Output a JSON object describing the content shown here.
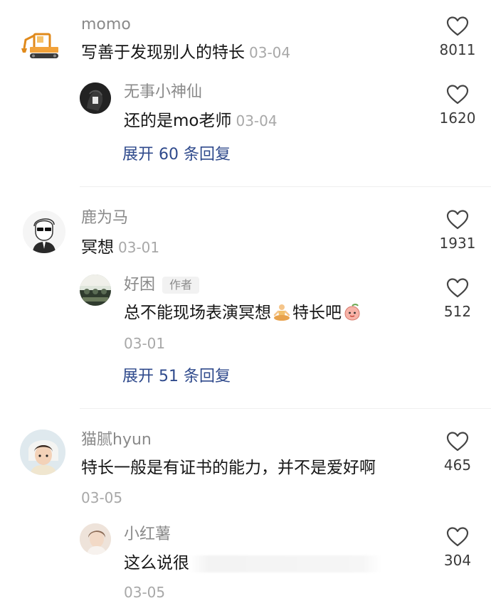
{
  "comments": [
    {
      "user": "momo",
      "text": "写善于发现别人的特长",
      "date": "03-04",
      "likes": "8011",
      "reply": {
        "user": "无事小神仙",
        "text": "还的是mo老师",
        "date": "03-04",
        "likes": "1620"
      },
      "expand": "展开 60 条回复"
    },
    {
      "user": "鹿为马",
      "text": "冥想",
      "date": "03-01",
      "likes": "1931",
      "reply": {
        "user": "好困",
        "badge": "作者",
        "text_a": "总不能现场表演冥想",
        "text_b": "特长吧",
        "date": "03-01",
        "likes": "512"
      },
      "expand": "展开 51 条回复"
    },
    {
      "user": "猫腻hyun",
      "text": "特长一般是有证书的能力，并不是爱好啊",
      "date": "03-05",
      "likes": "465",
      "reply": {
        "user": "小红薯",
        "text": "这么说很",
        "date": "03-05",
        "likes": "304"
      }
    }
  ],
  "icons": {
    "like": "heart-outline-icon",
    "meditate": "person-meditating-emoji",
    "peach": "peach-face-emoji"
  },
  "colors": {
    "name": "#8a8a8a",
    "text": "#161616",
    "date": "#a8a8a8",
    "expand": "#2f4a8c",
    "avatar_excavator": "#f2a23a"
  }
}
